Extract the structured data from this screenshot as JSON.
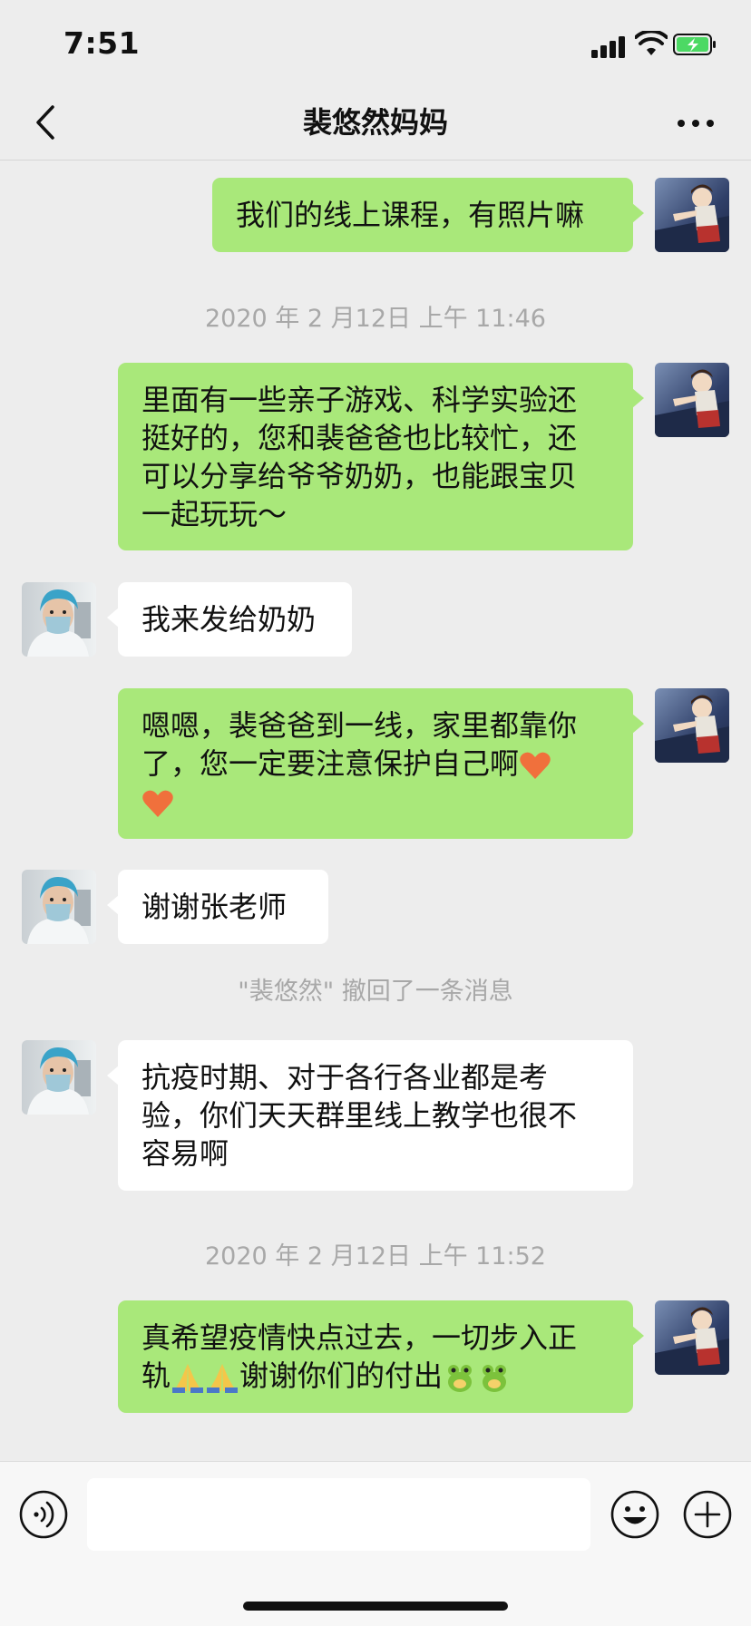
{
  "status_bar": {
    "time": "7:51"
  },
  "header": {
    "title": "裴悠然妈妈"
  },
  "messages": [
    {
      "type": "sent",
      "text": "我们的线上课程，有照片嘛"
    },
    {
      "type": "timestamp",
      "text": "2020 年 2 月12日  上午 11:46"
    },
    {
      "type": "sent",
      "lines": [
        "里面有一些亲子游戏、科学实验还",
        "挺好的，您和裴爸爸也比较忙，还",
        "可以分享给爷爷奶奶，也能跟宝贝",
        "一起玩玩～"
      ]
    },
    {
      "type": "received",
      "text": "我来发给奶奶"
    },
    {
      "type": "sent",
      "lines": [
        "嗯嗯，裴爸爸到一线，家里都靠你",
        "了，您一定要注意保护自己啊"
      ],
      "emojis": [
        "heart-icon",
        "heart-icon"
      ]
    },
    {
      "type": "received",
      "text": "谢谢张老师"
    },
    {
      "type": "system",
      "text": "\"裴悠然\" 撤回了一条消息"
    },
    {
      "type": "received",
      "lines": [
        "抗疫时期、对于各行各业都是考",
        "验，你们天天群里线上教学也很不",
        "容易啊"
      ]
    },
    {
      "type": "timestamp",
      "text": "2020 年 2 月12日  上午 11:52"
    },
    {
      "type": "sent",
      "lines": [
        "真希望疫情快点过去，一切步入正",
        "轨",
        "谢谢你们的付出"
      ],
      "emojis": [
        "pray-icon",
        "pray-icon",
        "frog-icon",
        "frog-icon"
      ]
    }
  ],
  "input": {
    "placeholder": ""
  },
  "colors": {
    "sent_bubble": "#a9e87a",
    "received_bubble": "#ffffff",
    "background": "#ededed",
    "timestamp": "#a8a8a8"
  }
}
